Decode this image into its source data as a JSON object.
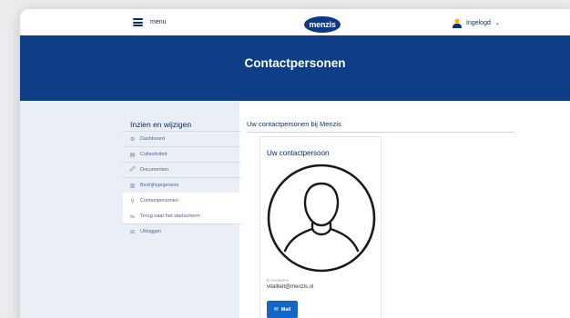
{
  "header": {
    "menu_label": "menu",
    "logo_text": "menzis",
    "login_label": "Ingelogd",
    "login_chevron": "⌄",
    "icons": [
      "hamburger-icon",
      "user-icon",
      "chevron-down-icon"
    ]
  },
  "banner": {
    "title": "Contactpersonen",
    "color": "#0d3e86"
  },
  "sidebar": {
    "title": "Inzien en wijzigen",
    "items": [
      {
        "label": "Dashboard",
        "icon": "⚙",
        "icon_name": "dashboard-icon"
      },
      {
        "label": "Collectiviteit",
        "icon": "▤",
        "icon_name": "collectivity-icon"
      },
      {
        "label": "Documenten",
        "icon": "🖉",
        "icon_name": "documents-icon"
      },
      {
        "label": "Bedrijfsgegevens",
        "icon": "▥",
        "icon_name": "company-icon"
      },
      {
        "label": "Contactpersonen",
        "icon": "⚲",
        "icon_name": "contacts-icon"
      },
      {
        "label": "Terug naar het startscherm",
        "icon": "⇆",
        "icon_name": "back-icon"
      },
      {
        "label": "Uitloggen",
        "icon": "⊞",
        "icon_name": "logout-icon"
      }
    ]
  },
  "main": {
    "title": "Uw contactpersonen bij Menzis",
    "card": {
      "title": "Uw contactpersoon",
      "email_label": "E-mailadres",
      "email_value": "vitaliteit@menzis.nl",
      "mail_button": "Mail",
      "mail_icon": "✉"
    }
  },
  "colors": {
    "brand_blue": "#0d3e86",
    "button_blue": "#1266c8",
    "sidebar_bg": "#eaeef5"
  }
}
